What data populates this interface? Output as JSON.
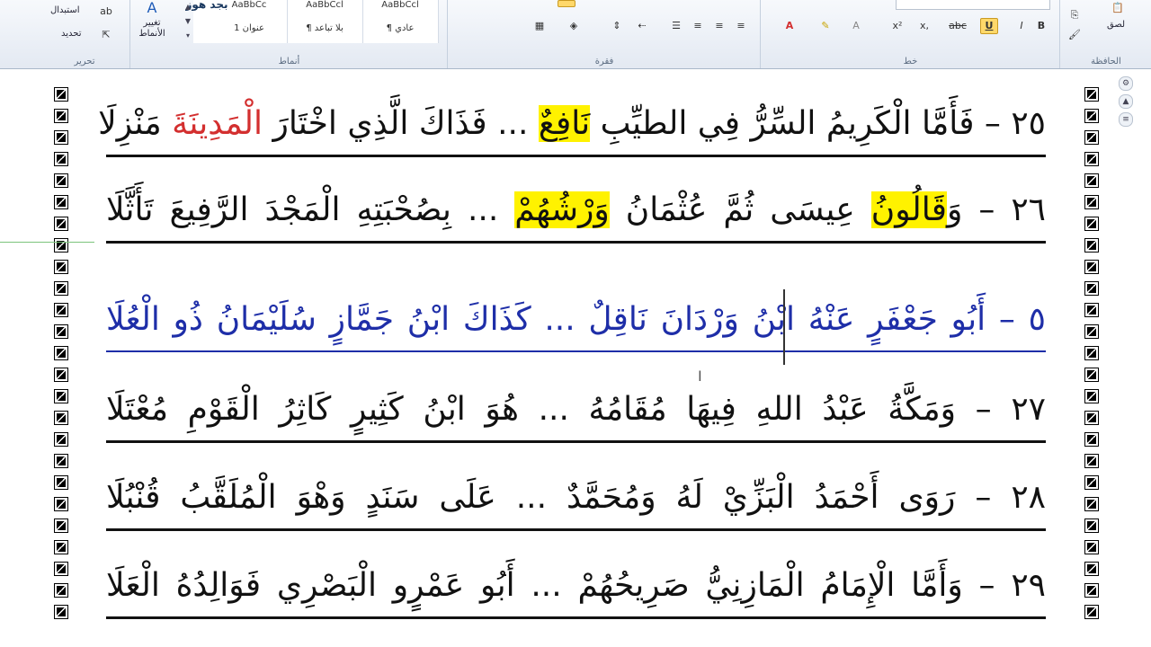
{
  "ribbon": {
    "clipboard": {
      "label": "الحافظة",
      "paste": "لصق"
    },
    "font": {
      "label": "خط",
      "bold": "B",
      "italic": "I",
      "underline": "U",
      "strike": "abc",
      "subscript": "x,",
      "superscript": "x²"
    },
    "paragraph": {
      "label": "فقرة"
    },
    "styles": {
      "label": "أنماط",
      "items": [
        {
          "sample": "AaBbCcl",
          "name": "¶ عادي"
        },
        {
          "sample": "AaBbCcl",
          "name": "¶ بلا تباعد"
        },
        {
          "sample": "AaBbCc",
          "name": "عنوان 1"
        },
        {
          "sample": "بجد هوز",
          "name": ""
        }
      ],
      "change_styles": "تغيير الأنماط"
    },
    "editing": {
      "label": "تحرير",
      "replace": "استبدال",
      "select": "تحديد"
    }
  },
  "document": {
    "verses": [
      {
        "number": "٢٥",
        "parts": [
          {
            "t": "– فَأَمَّا الْكَرِيمُ السِّرُّ فِي الطيِّبِ ",
            "s": ""
          },
          {
            "t": "نَافِعٌ",
            "s": "hl"
          },
          {
            "t": " ... فَذَاكَ الَّذِي اخْتَارَ ",
            "s": ""
          },
          {
            "t": "الْمَدِينَةَ",
            "s": "red"
          },
          {
            "t": " مَنْزِلَا",
            "s": ""
          }
        ]
      },
      {
        "number": "٢٦",
        "parts": [
          {
            "t": "– وَ",
            "s": ""
          },
          {
            "t": "قَالُونُ",
            "s": "hl"
          },
          {
            "t": " عِيسَى ثُمَّ عُثْمَانُ ",
            "s": ""
          },
          {
            "t": "وَرْشُهُمْ",
            "s": "hl"
          },
          {
            "t": " ... بِصُحْبَتِهِ الْمَجْدَ الرَّفِيعَ تَأَثَّلَا",
            "s": ""
          }
        ]
      },
      {
        "number": "٥",
        "parts": [
          {
            "t": "– أَبُو جَعْفَرٍ عَنْهُ ابْنُ وَرْدَانَ نَاقِلٌ ... كَذَاكَ ابْنُ جَمَّازٍ سُلَيْمَانُ ذُو الْعُلَا",
            "s": ""
          }
        ]
      },
      {
        "number": "٢٧",
        "parts": [
          {
            "t": "– وَمَكَّةُ عَبْدُ اللهِ فِيهَا مُقَامُهُ ... هُوَ ابْنُ كَثِيرٍ كَاثِرُ الْقَوْمِ مُعْتَلَا",
            "s": ""
          }
        ]
      },
      {
        "number": "٢٨",
        "parts": [
          {
            "t": "– رَوَى أَحْمَدُ الْبَزِّيْ لَهُ وَمُحَمَّدٌ ... عَلَى سَنَدٍ وَهْوَ الْمُلَقَّبُ قُنْبُلَا",
            "s": ""
          }
        ]
      },
      {
        "number": "٢٩",
        "parts": [
          {
            "t": "– وَأَمَّا الْإِمَامُ الْمَازِنِيُّ صَرِيحُهُمْ ... أَبُو عَمْرٍو الْبَصْرِي فَوَالِدُهُ الْعَلَا",
            "s": ""
          }
        ]
      }
    ]
  },
  "colors": {
    "highlight": "#fff200",
    "red": "#d32f2f",
    "blue": "#1e2ea8",
    "ribbon": "#e3e9f2"
  }
}
